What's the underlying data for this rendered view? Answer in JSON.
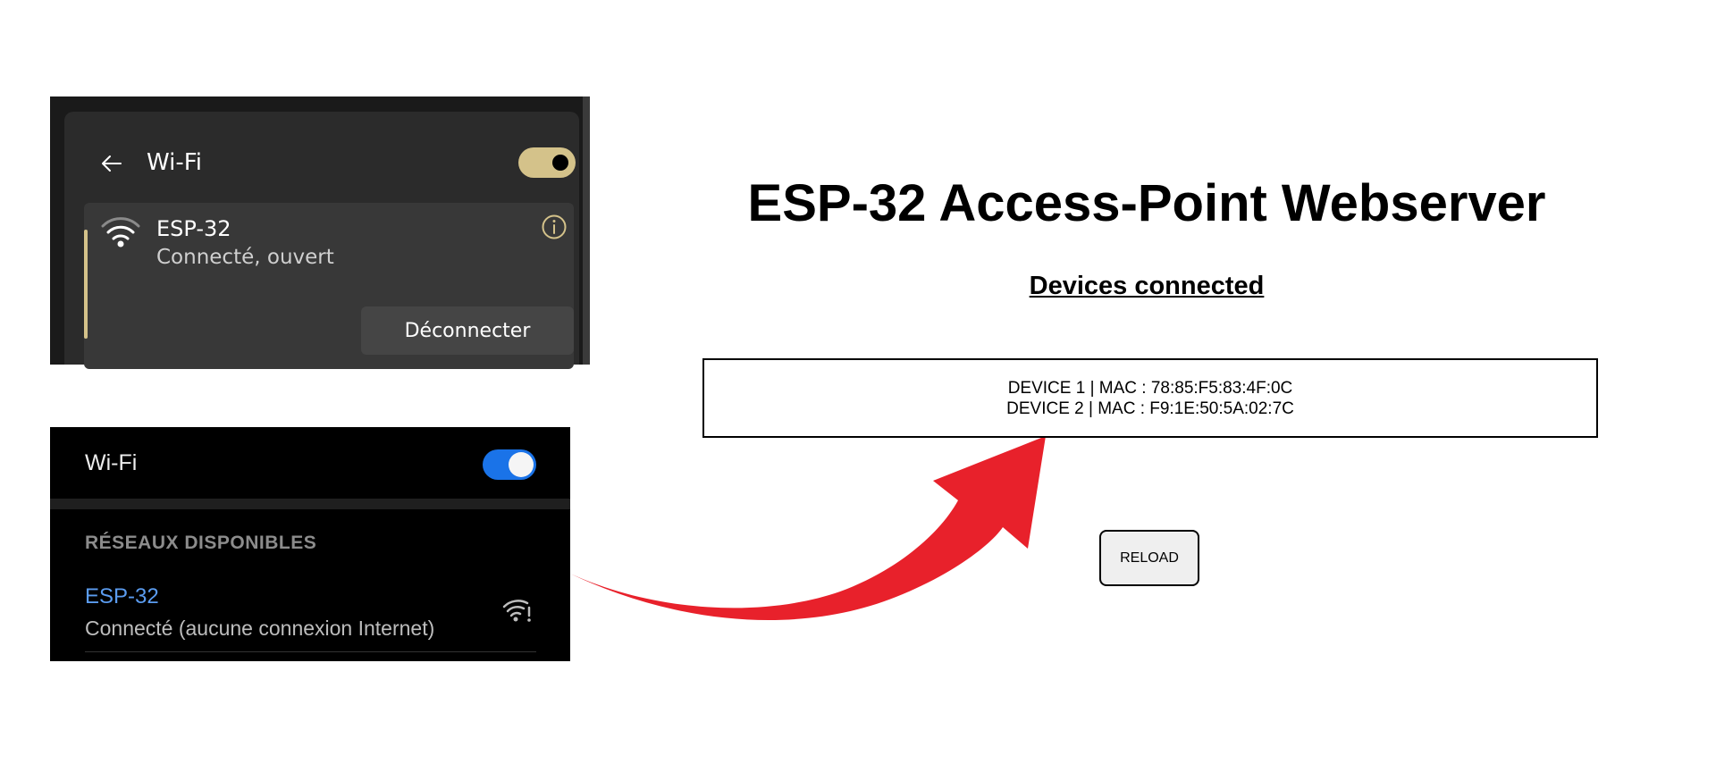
{
  "windows_flyout": {
    "title": "Wi-Fi",
    "toggle_on": true,
    "accent_color": "#d4c28a",
    "network": {
      "ssid": "ESP-32",
      "status": "Connecté, ouvert",
      "disconnect_label": "Déconnecter",
      "icon": "wifi-signal-icon"
    }
  },
  "android_panel": {
    "title": "Wi-Fi",
    "toggle_on": true,
    "toggle_color": "#1a73e8",
    "section_header": "RÉSEAUX DISPONIBLES",
    "network": {
      "ssid": "ESP-32",
      "status": "Connecté (aucune connexion Internet)",
      "icon": "wifi-no-internet-icon"
    }
  },
  "arrow": {
    "color": "#e8212b",
    "icon": "curved-arrow-icon"
  },
  "webserver": {
    "title": "ESP-32 Access-Point Webserver",
    "subtitle": "Devices connected",
    "devices": [
      "DEVICE 1 | MAC : 78:85:F5:83:4F:0C",
      "DEVICE 2 | MAC : F9:1E:50:5A:02:7C"
    ],
    "reload_label": "RELOAD"
  }
}
